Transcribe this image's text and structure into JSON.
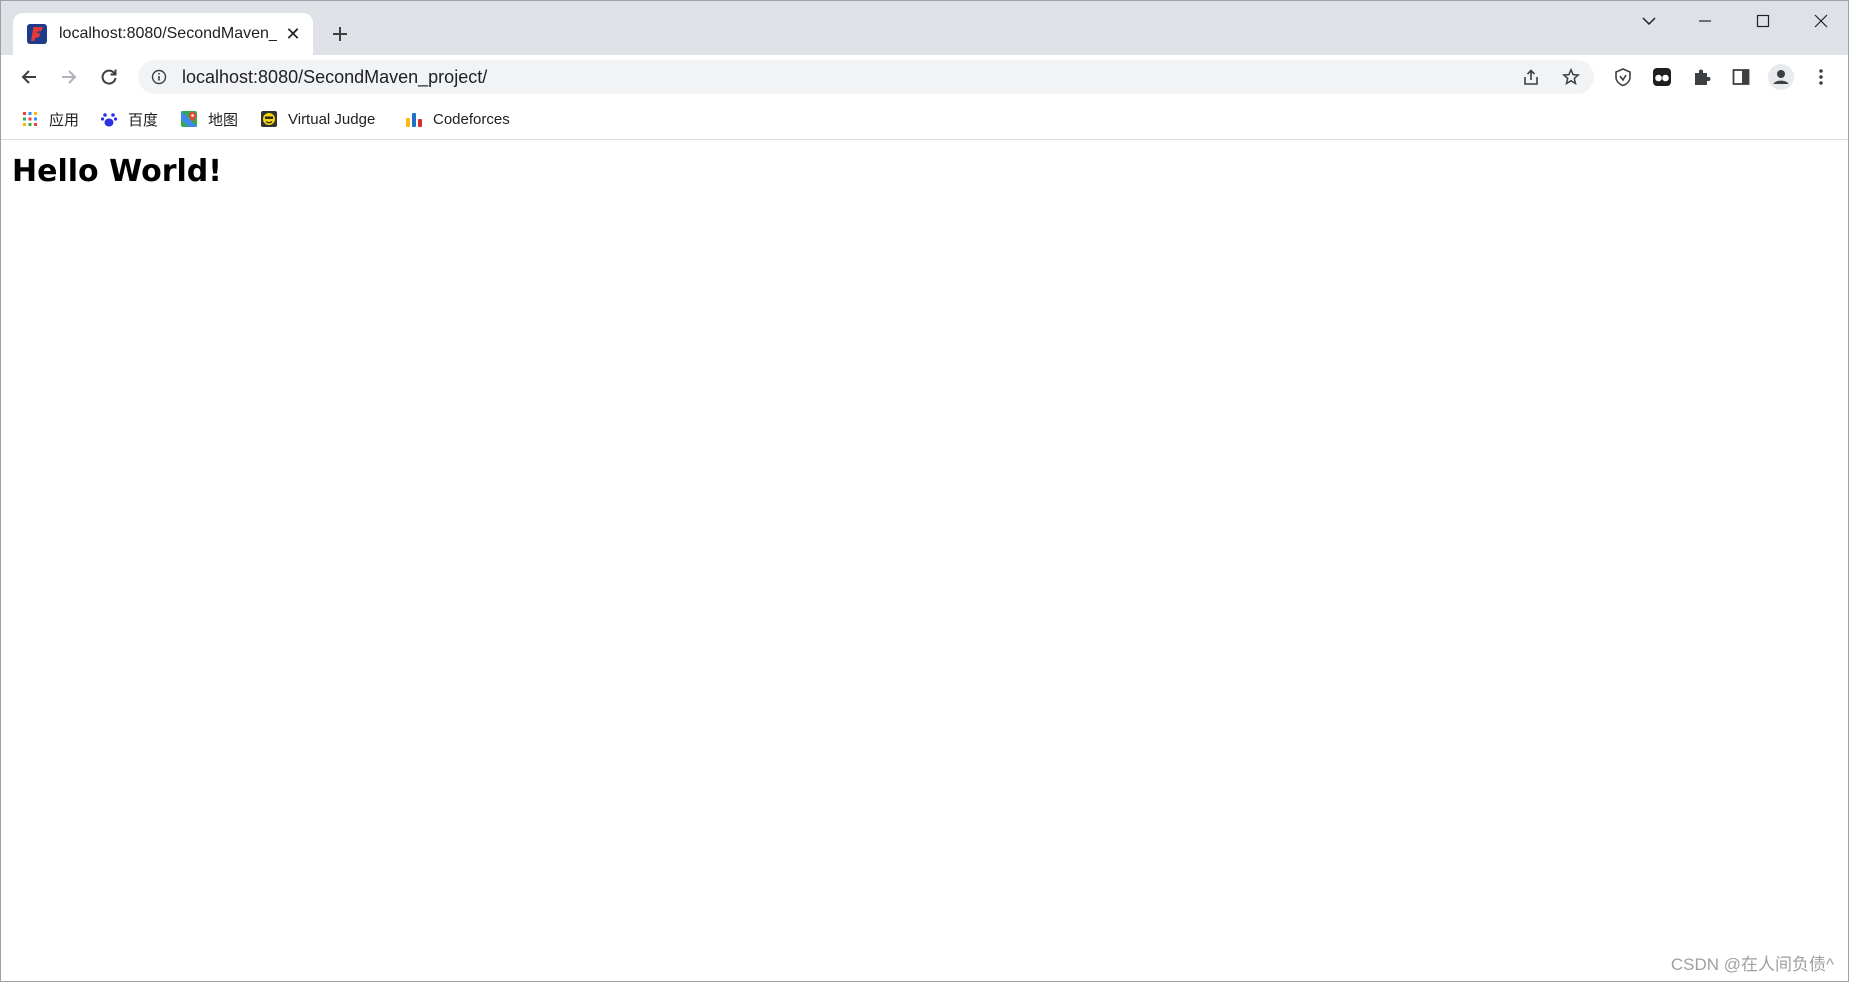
{
  "tab": {
    "title": "localhost:8080/SecondMaven_",
    "close_glyph": "✕",
    "favicon": "intellij-favicon-icon"
  },
  "new_tab_label": "+",
  "toolbar": {
    "url": "localhost:8080/SecondMaven_project/",
    "icons": [
      "back-arrow-icon",
      "forward-arrow-icon",
      "reload-icon",
      "info-icon",
      "share-icon",
      "star-icon",
      "shield-extension-icon",
      "tampermonkey-extension-icon",
      "puzzle-icon",
      "side-panel-icon",
      "profile-icon",
      "more-menu-icon"
    ]
  },
  "bookmarks": [
    {
      "label": "应用",
      "icon": "apps-grid-icon"
    },
    {
      "label": "百度",
      "icon": "baidu-paw-icon"
    },
    {
      "label": "地图",
      "icon": "maps-pin-icon"
    },
    {
      "label": "Virtual Judge",
      "icon": "virtual-judge-icon"
    },
    {
      "label": "Codeforces",
      "icon": "codeforces-bars-icon"
    }
  ],
  "page": {
    "heading": "Hello World!"
  },
  "watermark": "CSDN @在人间负债^",
  "colors": {
    "tabstrip": "#dee1e6",
    "omnibox": "#f1f3f4",
    "text": "#202124"
  }
}
